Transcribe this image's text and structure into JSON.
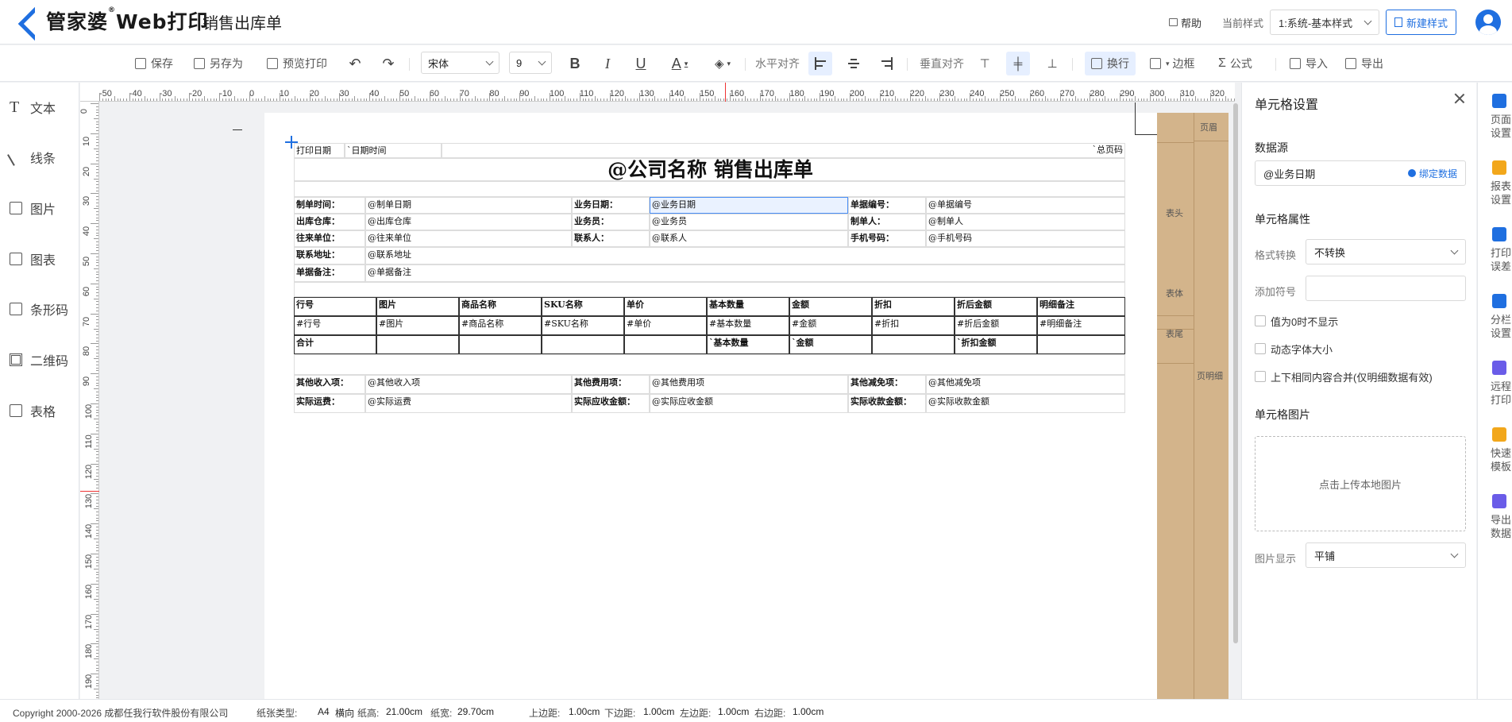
{
  "header": {
    "brand": "管家婆",
    "brand_sub": "Web打印",
    "brand_reg": "®",
    "page_title": "销售出库单",
    "help": "帮助",
    "current_style_label": "当前样式",
    "current_style_value": "1:系统-基本样式",
    "new_style": "新建样式"
  },
  "toolbar": {
    "save": "保存",
    "save_as": "另存为",
    "preview_print": "预览打印",
    "font_family": "宋体",
    "font_size": "9",
    "bold": "B",
    "italic": "I",
    "underline": "U",
    "font_color": "A",
    "h_align_label": "水平对齐",
    "v_align_label": "垂直对齐",
    "wrap": "换行",
    "border": "边框",
    "formula": "公式",
    "import": "导入",
    "export": "导出"
  },
  "left_tools": [
    "文本",
    "线条",
    "图片",
    "图表",
    "条形码",
    "二维码",
    "表格"
  ],
  "ruler": {
    "h_labels": [
      "-50",
      "-40",
      "-30",
      "-20",
      "-10",
      "0",
      "10",
      "20",
      "30",
      "40",
      "50",
      "60",
      "70",
      "80",
      "90",
      "100",
      "110",
      "120",
      "130",
      "140",
      "150",
      "160",
      "170",
      "180",
      "190",
      "200",
      "210",
      "220",
      "230",
      "240",
      "250",
      "260",
      "270",
      "280",
      "290",
      "300",
      "310",
      "320"
    ],
    "v_labels": [
      "0",
      "10",
      "20",
      "30",
      "40",
      "50",
      "60",
      "70",
      "80",
      "90",
      "100",
      "110",
      "120",
      "130",
      "140",
      "150",
      "160",
      "170",
      "180",
      "190"
    ]
  },
  "bands": {
    "page_header": "页眉",
    "table_header": "表头",
    "table_body": "表体",
    "table_footer": "表尾",
    "page_detail": "页明细"
  },
  "report": {
    "r0": [
      "打印日期",
      "`日期时间",
      "`总页码"
    ],
    "title": "@公司名称 销售出库单",
    "info": [
      [
        "制单时间：",
        "@制单日期",
        "业务日期：",
        "@业务日期",
        "单据编号：",
        "@单据编号"
      ],
      [
        "出库仓库：",
        "@出库仓库",
        "业务员：",
        "@业务员",
        "制单人：",
        "@制单人"
      ],
      [
        "往来单位：",
        "@往来单位",
        "联系人：",
        "@联系人",
        "手机号码：",
        "@手机号码"
      ],
      [
        "联系地址：",
        "@联系地址"
      ],
      [
        "单据备注：",
        "@单据备注"
      ]
    ],
    "detail_head": [
      "行号",
      "图片",
      "商品名称",
      "SKU名称",
      "单价",
      "基本数量",
      "金额",
      "折扣",
      "折后金额",
      "明细备注"
    ],
    "detail_row": [
      "#行号",
      "#图片",
      "#商品名称",
      "#SKU名称",
      "#单价",
      "#基本数量",
      "#金额",
      "#折扣",
      "#折后金额",
      "#明细备注"
    ],
    "detail_sum": [
      "合计",
      "",
      "",
      "",
      "",
      "`基本数量",
      "`金额",
      "",
      "`折扣金额",
      ""
    ],
    "footer": [
      [
        "其他收入项：",
        "@其他收入项",
        "其他费用项：",
        "@其他费用项",
        "其他减免项：",
        "@其他减免项"
      ],
      [
        "实际运费：",
        "@实际运费",
        "实际应收金额：",
        "@实际应收金额",
        "实际收款金额：",
        "@实际收款金额"
      ]
    ]
  },
  "cell_panel": {
    "title": "单元格设置",
    "datasource_label": "数据源",
    "datasource_value": "@业务日期",
    "bind_data": "绑定数据",
    "props_label": "单元格属性",
    "format_label": "格式转换",
    "format_value": "不转换",
    "symbol_label": "添加符号",
    "symbol_value": "",
    "chk_zero": "值为0时不显示",
    "chk_dynamic": "动态字体大小",
    "chk_merge": "上下相同内容合并(仅明细数据有效)",
    "image_label": "单元格图片",
    "upload": "点击上传本地图片",
    "image_display_label": "图片显示",
    "image_display_value": "平铺"
  },
  "far_right": [
    {
      "l1": "页面",
      "l2": "设置",
      "color": "#1f6fe0"
    },
    {
      "l1": "报表",
      "l2": "设置",
      "color": "#f2a71b"
    },
    {
      "l1": "打印",
      "l2": "误差",
      "color": "#1f6fe0"
    },
    {
      "l1": "分栏",
      "l2": "设置",
      "color": "#1f6fe0"
    },
    {
      "l1": "远程",
      "l2": "打印",
      "color": "#6a5ce8"
    },
    {
      "l1": "快速",
      "l2": "模板",
      "color": "#f2a71b"
    },
    {
      "l1": "导出",
      "l2": "数据",
      "color": "#6a5ce8"
    }
  ],
  "status": {
    "copyright": "Copyright 2000-2026 成都任我行软件股份有限公司",
    "paper_type_label": "纸张类型:",
    "paper_type": "A4",
    "orientation": "横向",
    "paper_height_label": "纸高:",
    "paper_height": "21.00cm",
    "paper_width_label": "纸宽:",
    "paper_width": "29.70cm",
    "top_label": "上边距:",
    "top": "1.00cm",
    "bottom_label": "下边距:",
    "bottom": "1.00cm",
    "left_label": "左边距:",
    "left": "1.00cm",
    "right_label": "右边距:",
    "right": "1.00cm"
  }
}
